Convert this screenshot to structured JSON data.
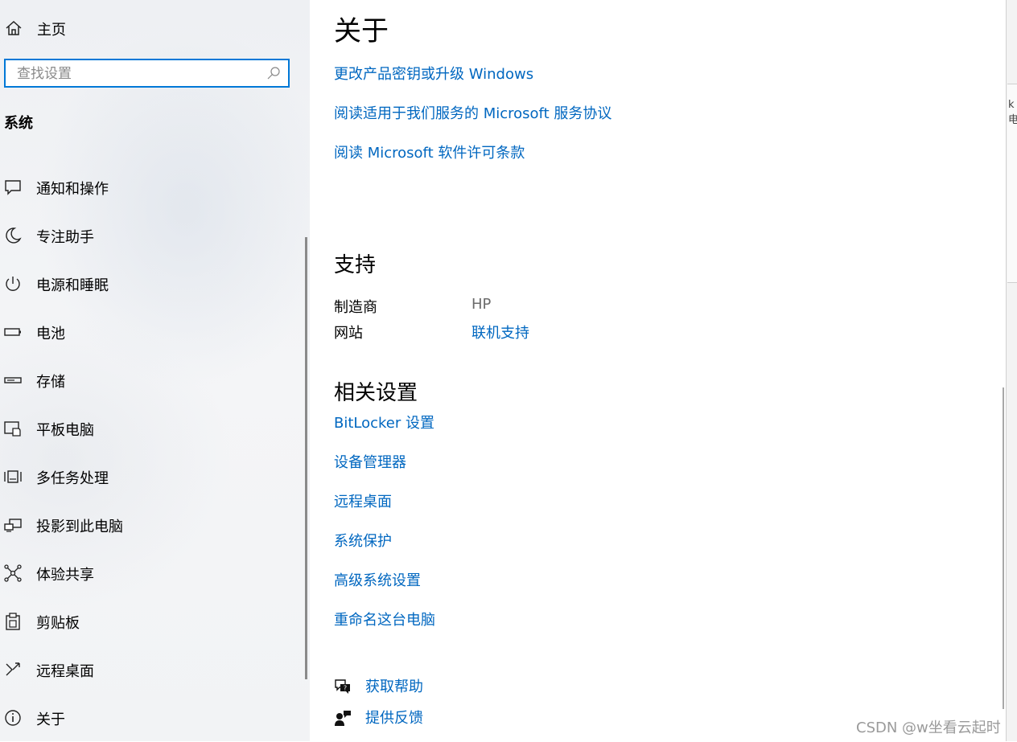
{
  "sidebar": {
    "home_label": "主页",
    "search_placeholder": "查找设置",
    "section_title": "系统",
    "items": [
      {
        "label": "通知和操作",
        "icon": "notification-icon"
      },
      {
        "label": "专注助手",
        "icon": "moon-icon"
      },
      {
        "label": "电源和睡眠",
        "icon": "power-icon"
      },
      {
        "label": "电池",
        "icon": "battery-icon"
      },
      {
        "label": "存储",
        "icon": "storage-icon"
      },
      {
        "label": "平板电脑",
        "icon": "tablet-icon"
      },
      {
        "label": "多任务处理",
        "icon": "multitasking-icon"
      },
      {
        "label": "投影到此电脑",
        "icon": "project-icon"
      },
      {
        "label": "体验共享",
        "icon": "share-icon"
      },
      {
        "label": "剪贴板",
        "icon": "clipboard-icon"
      },
      {
        "label": "远程桌面",
        "icon": "remote-desktop-icon"
      },
      {
        "label": "关于",
        "icon": "info-icon"
      }
    ]
  },
  "main": {
    "about_title": "关于",
    "about_links": [
      "更改产品密钥或升级 Windows",
      "阅读适用于我们服务的 Microsoft 服务协议",
      "阅读 Microsoft 软件许可条款"
    ],
    "support_title": "支持",
    "support": {
      "manufacturer_label": "制造商",
      "manufacturer_value": "HP",
      "website_label": "网站",
      "website_link": "联机支持"
    },
    "related_title": "相关设置",
    "related_links": [
      "BitLocker 设置",
      "设备管理器",
      "远程桌面",
      "系统保护",
      "高级系统设置",
      "重命名这台电脑"
    ],
    "help_label": "获取帮助",
    "feedback_label": "提供反馈"
  },
  "right_edge_fragment": "k电",
  "watermark": "CSDN @w坐看云起时",
  "colors": {
    "accent": "#0078d7",
    "link": "#0067c0"
  }
}
